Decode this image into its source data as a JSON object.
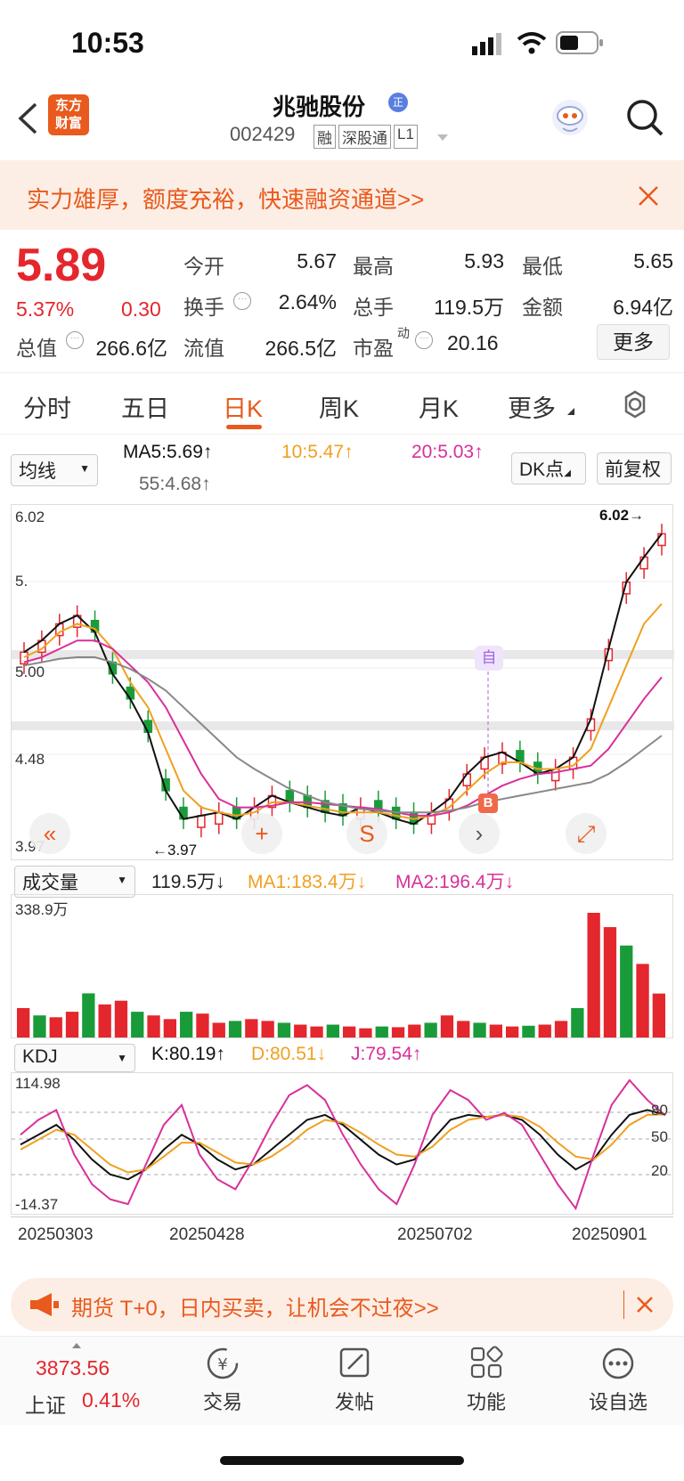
{
  "status_bar": {
    "time": "10:53"
  },
  "header": {
    "logo_text_1": "东方",
    "logo_text_2": "财富",
    "stock_name": "兆驰股份",
    "badge": "正",
    "stock_code": "002429",
    "tags": [
      "融",
      "深股通",
      "L1"
    ]
  },
  "banner": {
    "text": "实力雄厚，额度充裕，快速融资通道>>"
  },
  "quote": {
    "price": "5.89",
    "change_pct": "5.37%",
    "change": "0.30",
    "open_label": "今开",
    "open": "5.67",
    "high_label": "最高",
    "high": "5.93",
    "low_label": "最低",
    "low": "5.65",
    "turnover_label": "换手",
    "turnover": "2.64%",
    "volume_label": "总手",
    "volume": "119.5万",
    "amount_label": "金额",
    "amount": "6.94亿",
    "mcap_label": "总值",
    "mcap": "266.6亿",
    "float_label": "流值",
    "float": "266.5亿",
    "pe_label": "市盈",
    "pe_sup": "动",
    "pe": "20.16",
    "more_button": "更多"
  },
  "tabs": [
    "分时",
    "五日",
    "日K",
    "周K",
    "月K",
    "更多"
  ],
  "active_tab": "日K",
  "indicator_bar": {
    "ma_select": "均线",
    "ma5": "MA5:5.69",
    "ma10": "10:5.47",
    "ma20": "20:5.03",
    "ma55": "55:4.68",
    "dk_button": "DK点",
    "adjust_button": "前复权"
  },
  "colors": {
    "up": "#e4262d",
    "down": "#1a9b3a",
    "ma5": "#111111",
    "ma10": "#f0a020",
    "ma20": "#d8309a",
    "ma55": "#888888",
    "accent": "#e85a1d"
  },
  "price_chart": {
    "y_labels": [
      "6.02",
      "5.",
      "5.00",
      "4.48",
      "3.97"
    ],
    "max_marker": "6.02",
    "min_marker": "3.97",
    "self_marker": "自",
    "buy_marker": "B",
    "ylim": [
      3.97,
      6.02
    ]
  },
  "chart_controls": [
    "«",
    "+",
    "S",
    "›",
    "⤢"
  ],
  "volume": {
    "select": "成交量",
    "value": "119.5万",
    "ma1": "MA1:183.4万",
    "ma2": "MA2:196.4万",
    "max_label": "338.9万"
  },
  "kdj": {
    "select": "KDJ",
    "k": "K:80.19",
    "d": "D:80.51",
    "j": "J:79.54",
    "max_label": "114.98",
    "min_label": "-14.37",
    "levels": [
      "80",
      "50",
      "20"
    ]
  },
  "dates": [
    "20250303",
    "20250428",
    "20250702",
    "20250901"
  ],
  "bottom_banner": {
    "text": "期货 T+0，日内买卖，让机会不过夜>>"
  },
  "bottom_nav": {
    "index_value": "3873.56",
    "index_name": "上证",
    "index_change": "0.41%",
    "items": [
      "交易",
      "发帖",
      "功能",
      "设自选"
    ]
  },
  "chart_data": [
    {
      "type": "line",
      "title": "",
      "series": [
        {
          "name": "MA5",
          "values": [
            5.18,
            5.25,
            5.35,
            5.4,
            5.3,
            5.05,
            4.9,
            4.7,
            4.35,
            4.18,
            4.2,
            4.22,
            4.18,
            4.25,
            4.32,
            4.28,
            4.25,
            4.22,
            4.2,
            4.25,
            4.22,
            4.18,
            4.15,
            4.22,
            4.3,
            4.45,
            4.55,
            4.58,
            4.52,
            4.45,
            4.48,
            4.55,
            4.78,
            5.2,
            5.6,
            5.75,
            5.89
          ]
        },
        {
          "name": "MA10",
          "values": [
            5.15,
            5.2,
            5.3,
            5.35,
            5.32,
            5.2,
            5.0,
            4.85,
            4.6,
            4.35,
            4.25,
            4.22,
            4.2,
            4.22,
            4.28,
            4.28,
            4.26,
            4.24,
            4.22,
            4.22,
            4.22,
            4.2,
            4.18,
            4.2,
            4.25,
            4.35,
            4.45,
            4.52,
            4.52,
            4.48,
            4.48,
            4.5,
            4.6,
            4.85,
            5.1,
            5.35,
            5.47
          ]
        },
        {
          "name": "MA20",
          "values": [
            5.12,
            5.15,
            5.2,
            5.25,
            5.25,
            5.2,
            5.1,
            5.0,
            4.85,
            4.65,
            4.45,
            4.3,
            4.25,
            4.25,
            4.26,
            4.28,
            4.28,
            4.27,
            4.26,
            4.25,
            4.24,
            4.22,
            4.2,
            4.2,
            4.22,
            4.26,
            4.32,
            4.38,
            4.42,
            4.45,
            4.46,
            4.48,
            4.5,
            4.6,
            4.75,
            4.9,
            5.03
          ]
        },
        {
          "name": "MA55",
          "values": [
            5.1,
            5.12,
            5.14,
            5.15,
            5.15,
            5.12,
            5.08,
            5.02,
            4.95,
            4.85,
            4.75,
            4.65,
            4.55,
            4.48,
            4.42,
            4.36,
            4.32,
            4.28,
            4.26,
            4.24,
            4.23,
            4.22,
            4.22,
            4.22,
            4.23,
            4.25,
            4.28,
            4.3,
            4.32,
            4.34,
            4.36,
            4.38,
            4.4,
            4.45,
            4.52,
            4.6,
            4.68
          ]
        }
      ],
      "ylim": [
        3.97,
        6.02
      ]
    },
    {
      "type": "bar",
      "title": "",
      "values": [
        80,
        60,
        55,
        70,
        120,
        90,
        100,
        70,
        60,
        50,
        70,
        65,
        40,
        45,
        50,
        45,
        40,
        35,
        30,
        35,
        30,
        25,
        30,
        28,
        35,
        40,
        60,
        45,
        40,
        35,
        30,
        32,
        35,
        45,
        80,
        338.9,
        300,
        250,
        200,
        119.5
      ],
      "ylim": [
        0,
        338.9
      ]
    },
    {
      "type": "line",
      "title": "",
      "series": [
        {
          "name": "K",
          "values": [
            50,
            60,
            70,
            55,
            35,
            20,
            15,
            25,
            45,
            60,
            50,
            35,
            25,
            30,
            45,
            60,
            75,
            80,
            70,
            55,
            40,
            30,
            35,
            55,
            75,
            80,
            78,
            80,
            75,
            60,
            40,
            25,
            35,
            60,
            80,
            85,
            80.19
          ]
        },
        {
          "name": "D",
          "values": [
            45,
            55,
            65,
            60,
            45,
            30,
            22,
            25,
            38,
            52,
            52,
            42,
            32,
            30,
            38,
            50,
            65,
            75,
            72,
            62,
            50,
            40,
            38,
            48,
            65,
            75,
            78,
            80,
            78,
            68,
            52,
            38,
            35,
            50,
            70,
            80,
            80.51
          ]
        },
        {
          "name": "J",
          "values": [
            60,
            75,
            85,
            40,
            10,
            -5,
            -10,
            30,
            70,
            90,
            40,
            15,
            5,
            35,
            70,
            100,
            110,
            95,
            60,
            30,
            5,
            -10,
            30,
            80,
            105,
            95,
            75,
            82,
            70,
            40,
            10,
            -14.37,
            40,
            90,
            114.98,
            95,
            79.54
          ]
        }
      ],
      "ylim": [
        -14.37,
        114.98
      ]
    }
  ]
}
